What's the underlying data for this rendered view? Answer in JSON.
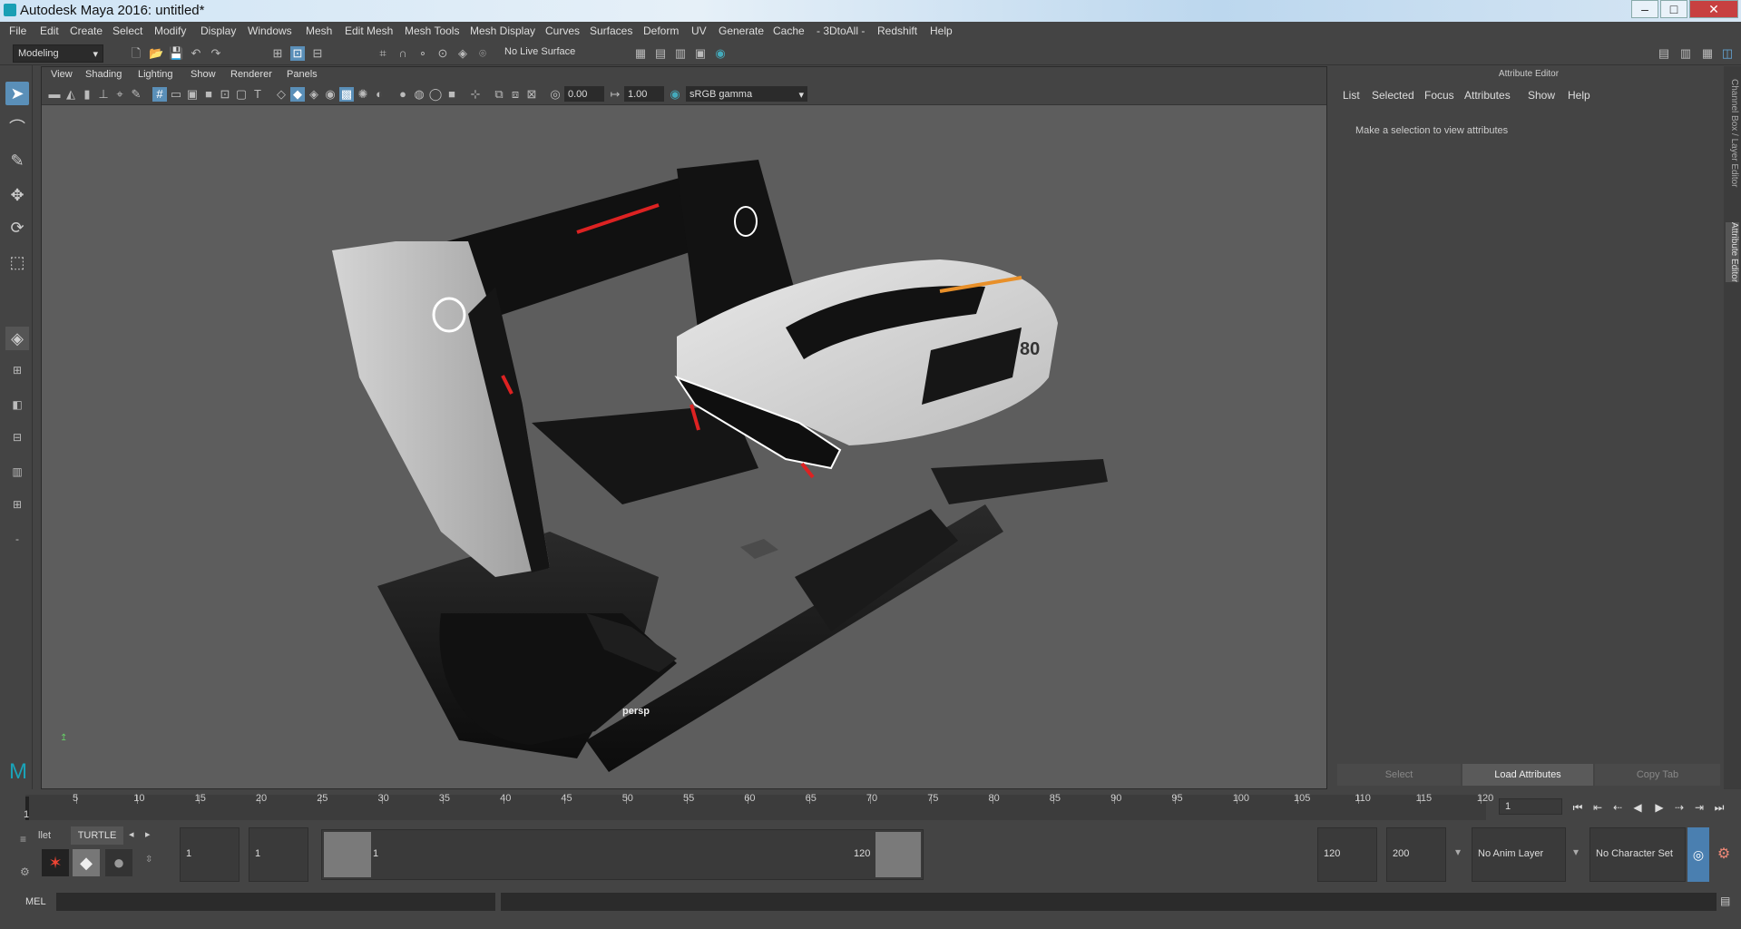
{
  "window": {
    "title": "Autodesk Maya 2016: untitled*",
    "minimize": "–",
    "maximize": "□",
    "close": "✕"
  },
  "menubar": [
    "File",
    "Edit",
    "Create",
    "Select",
    "Modify",
    "Display",
    "Windows",
    "Mesh",
    "Edit Mesh",
    "Mesh Tools",
    "Mesh Display",
    "Curves",
    "Surfaces",
    "Deform",
    "UV",
    "Generate",
    "Cache",
    "- 3DtoAll -",
    "Redshift",
    "Help"
  ],
  "toolbar": {
    "mode": "Modeling",
    "live_surface": "No Live Surface"
  },
  "viewport": {
    "menu": [
      "View",
      "Shading",
      "Lighting",
      "Show",
      "Renderer",
      "Panels"
    ],
    "exposure": "0.00",
    "gamma": "1.00",
    "color_space": "sRGB gamma",
    "camera_label": "persp",
    "model_badge": "80"
  },
  "attribute_editor": {
    "title": "Attribute Editor",
    "menu": [
      "List",
      "Selected",
      "Focus",
      "Attributes",
      "Show",
      "Help"
    ],
    "message": "Make a selection to view attributes",
    "buttons": {
      "select": "Select",
      "load": "Load Attributes",
      "copy": "Copy Tab"
    },
    "side_tabs": [
      "Channel Box / Layer Editor",
      "Attribute Editor"
    ]
  },
  "timeline": {
    "ticks": [
      "5",
      "10",
      "15",
      "20",
      "25",
      "30",
      "35",
      "40",
      "45",
      "50",
      "55",
      "60",
      "65",
      "70",
      "75",
      "80",
      "85",
      "90",
      "95",
      "100",
      "105",
      "110",
      "115",
      "120"
    ],
    "start_marker": "1",
    "current_frame": "1"
  },
  "range": {
    "shelf_tabs": [
      "llet",
      "TURTLE"
    ],
    "start_frame": "1",
    "playback_start": "1",
    "range_start_label": "1",
    "range_end_label": "120",
    "playback_end": "120",
    "end_frame": "200",
    "anim_layer": "No Anim Layer",
    "character_set": "No Character Set"
  },
  "command": {
    "label": "MEL"
  }
}
